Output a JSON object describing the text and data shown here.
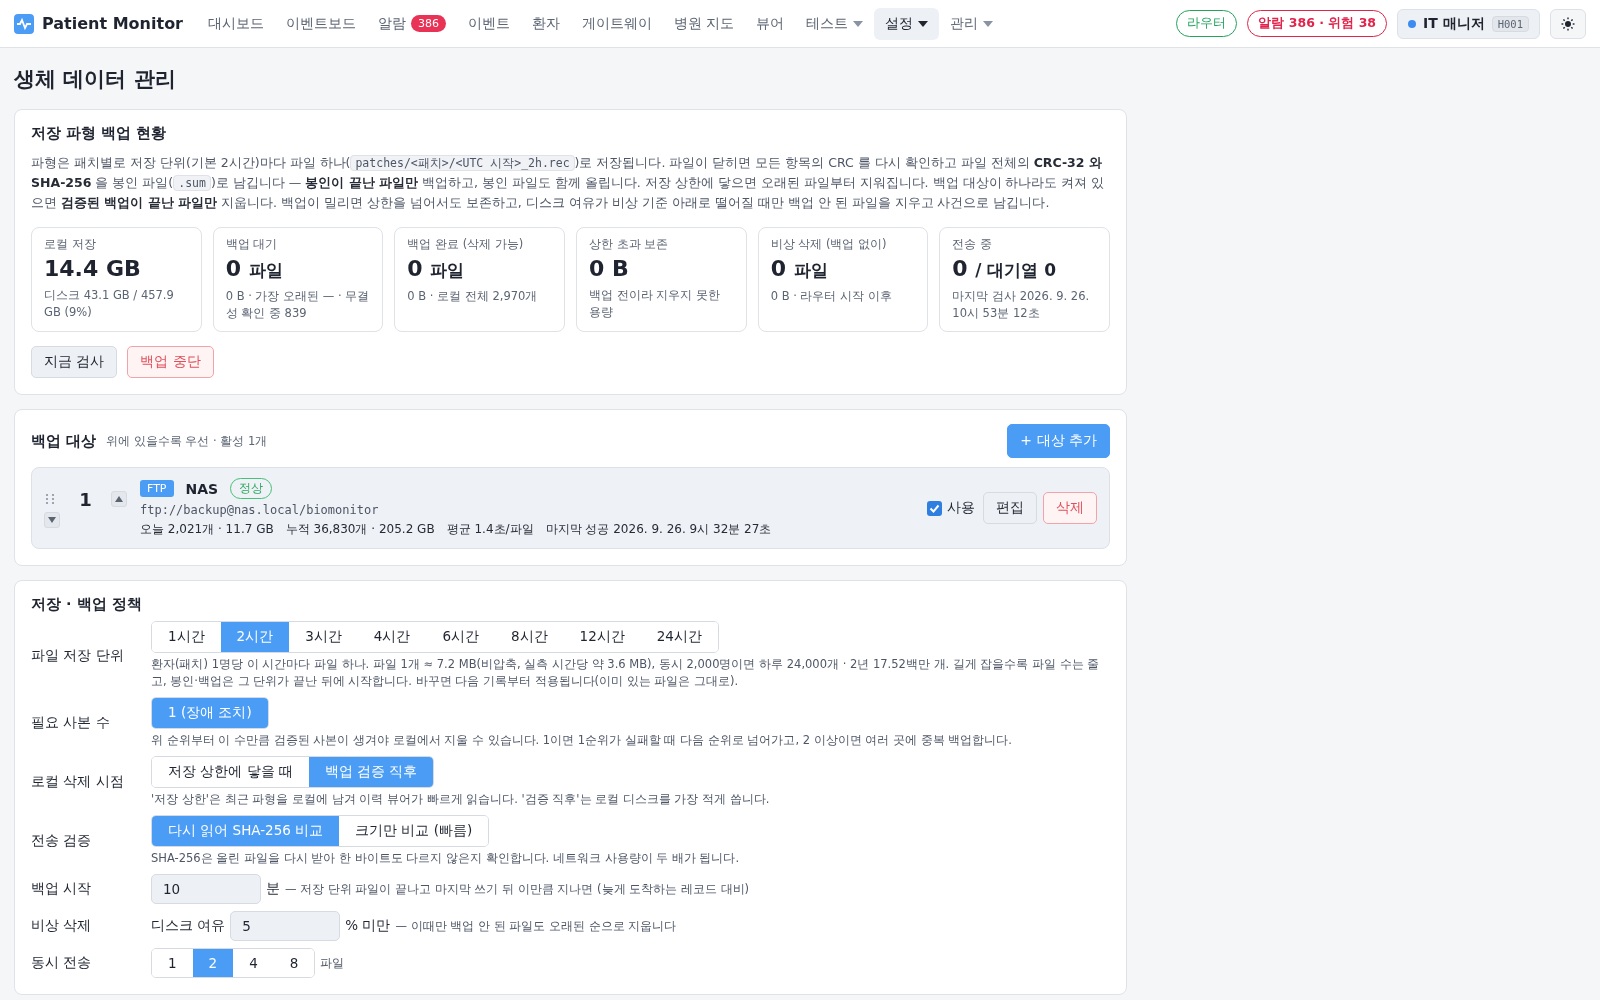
{
  "brand": {
    "name": "Patient Monitor"
  },
  "nav": [
    {
      "label": "대시보드",
      "selected": false,
      "dropdown": false
    },
    {
      "label": "이벤트보드",
      "selected": false,
      "dropdown": false
    },
    {
      "label": "알람",
      "selected": false,
      "dropdown": false,
      "badge": "386"
    },
    {
      "label": "이벤트",
      "selected": false,
      "dropdown": false
    },
    {
      "label": "환자",
      "selected": false,
      "dropdown": false
    },
    {
      "label": "게이트웨이",
      "selected": false,
      "dropdown": false
    },
    {
      "label": "병원 지도",
      "selected": false,
      "dropdown": false
    },
    {
      "label": "뷰어",
      "selected": false,
      "dropdown": false
    },
    {
      "label": "테스트",
      "selected": false,
      "dropdown": true
    },
    {
      "label": "설정",
      "selected": true,
      "dropdown": true
    },
    {
      "label": "관리",
      "selected": false,
      "dropdown": true
    }
  ],
  "status_pills": [
    {
      "label": "라우터",
      "color": "#22a45d"
    },
    {
      "label": "알람 386 · 위험 38",
      "color": "#e0244b"
    }
  ],
  "user": {
    "name": "IT 매니저",
    "code": "H001",
    "color": "#3b8cf0"
  },
  "page_title": "생체 데이터 관리",
  "storage": {
    "title": "저장 파형 백업 현황",
    "description": [
      {
        "kind": "text",
        "text": "파형은 패치별로 저장 단위(기본 2시간)마다 파일 하나("
      },
      {
        "kind": "code",
        "text": "patches/<패치>/<UTC 시작>_2h.rec"
      },
      {
        "kind": "text",
        "text": ")로 저장됩니다. 파일이 닫히면 모든 항목의 CRC 를 다시 확인하고 파일 전체의 **CRC-32 와 SHA-256** 을 봉인 파일("
      },
      {
        "kind": "code",
        "text": ".sum"
      },
      {
        "kind": "text",
        "text": ")로 남깁니다 — **봉인이 끝난 파일만** 백업하고, 봉인 파일도 함께 올립니다. 저장 상한에 닿으면 오래된 파일부터 지워집니다. 백업 대상이 하나라도 켜져 있으면 **검증된 백업이 끝난 파일만** 지웁니다. 백업이 밀리면 상한을 넘어서도 보존하고, 디스크 여유가 비상 기준 아래로 떨어질 때만 백업 안 된 파일을 지우고 사건으로 남깁니다."
      }
    ],
    "stats": [
      {
        "label": "로컬 저장",
        "value": "14.4 GB",
        "sub": "디스크 43.1 GB / 457.9 GB (9%)"
      },
      {
        "label": "백업 대기",
        "value": "0",
        "unit": "파일",
        "sub": "0 B · 가장 오래된 — · 무결성 확인 중 839"
      },
      {
        "label": "백업 완료 (삭제 가능)",
        "value": "0",
        "unit": "파일",
        "sub": "0 B · 로컬 전체 2,970개"
      },
      {
        "label": "상한 초과 보존",
        "value": "0 B",
        "sub": "백업 전이라 지우지 못한 용량"
      },
      {
        "label": "비상 삭제 (백업 없이)",
        "value": "0",
        "unit": "파일",
        "sub": "0 B · 라우터 시작 이후"
      },
      {
        "label": "전송 중",
        "value": "0",
        "unit": "/ 대기열 0",
        "sub": "마지막 검사 2026. 9. 26. 10시 53분 12초"
      }
    ],
    "actions": [
      {
        "label": "지금 검사",
        "kind": "neutral"
      },
      {
        "label": "백업 중단",
        "kind": "danger"
      }
    ]
  },
  "targets": {
    "title": "백업 대상",
    "subtitle": "위에 있을수록 우선 · 활성 1개",
    "add_button": "+ 대상 추가",
    "items": [
      {
        "rank": "1",
        "protocol": "FTP",
        "name": "NAS",
        "status": "정상",
        "url": "ftp://backup@nas.local/biomonitor",
        "stats": [
          "오늘 2,021개 · 11.7 GB",
          "누적 36,830개 · 205.2 GB",
          "평균 1.4초/파일",
          "마지막 성공 2026. 9. 26. 9시 32분 27초"
        ],
        "enabled": true,
        "enabled_label": "사용",
        "edit": "편집",
        "delete": "삭제"
      }
    ]
  },
  "policy": {
    "title": "저장 · 백업 정책",
    "rows": [
      {
        "kind": "segmented",
        "label": "파일 저장 단위",
        "options": [
          {
            "label": "1시간",
            "selected": false
          },
          {
            "label": "2시간",
            "selected": true
          },
          {
            "label": "3시간",
            "selected": false
          },
          {
            "label": "4시간",
            "selected": false
          },
          {
            "label": "6시간",
            "selected": false
          },
          {
            "label": "8시간",
            "selected": false
          },
          {
            "label": "12시간",
            "selected": false
          },
          {
            "label": "24시간",
            "selected": false
          }
        ],
        "help": "환자(패치) 1명당 이 시간마다 파일 하나. 파일 1개 ≈ 7.2 MB(비압축, 실측 시간당 약 3.6 MB), 동시 2,000명이면 하루 24,000개 · 2년 17.52백만 개. 길게 잡을수록 파일 수는 줄고, 봉인·백업은 그 단위가 끝난 뒤에 시작합니다. 바꾸면 다음 기록부터 적용됩니다(이미 있는 파일은 그대로)."
      },
      {
        "kind": "segmented",
        "label": "필요 사본 수",
        "options": [
          {
            "label": "1 (장애 조치)",
            "selected": true
          }
        ],
        "help": "위 순위부터 이 수만큼 검증된 사본이 생겨야 로컬에서 지울 수 있습니다. 1이면 1순위가 실패할 때 다음 순위로 넘어가고, 2 이상이면 여러 곳에 중복 백업합니다."
      },
      {
        "kind": "segmented",
        "label": "로컬 삭제 시점",
        "options": [
          {
            "label": "저장 상한에 닿을 때",
            "selected": false
          },
          {
            "label": "백업 검증 직후",
            "selected": true
          }
        ],
        "help": "'저장 상한'은 최근 파형을 로컬에 남겨 이력 뷰어가 빠르게 읽습니다. '검증 직후'는 로컬 디스크를 가장 적게 씁니다."
      },
      {
        "kind": "segmented",
        "label": "전송 검증",
        "options": [
          {
            "label": "다시 읽어 SHA-256 비교",
            "selected": true
          },
          {
            "label": "크기만 비교 (빠름)",
            "selected": false
          }
        ],
        "help": "SHA-256은 올린 파일을 다시 받아 한 바이트도 다르지 않은지 확인합니다. 네트워크 사용량이 두 배가 됩니다."
      },
      {
        "kind": "input",
        "label": "백업 시작",
        "value": "10",
        "suffix": "분",
        "note": "— 저장 단위 파일이 끝나고 마지막 쓰기 뒤 이만큼 지나면 (늦게 도착하는 레코드 대비)"
      },
      {
        "kind": "input",
        "label": "비상 삭제",
        "prefix": "디스크 여유",
        "value": "5",
        "suffix": "% 미만",
        "note": "— 이때만 백업 안 된 파일도 오래된 순으로 지웁니다"
      },
      {
        "kind": "segmented",
        "label": "동시 전송",
        "options": [
          {
            "label": "1",
            "selected": false
          },
          {
            "label": "2",
            "selected": true
          },
          {
            "label": "4",
            "selected": false
          },
          {
            "label": "8",
            "selected": false
          }
        ],
        "suffix": "파일"
      }
    ]
  }
}
